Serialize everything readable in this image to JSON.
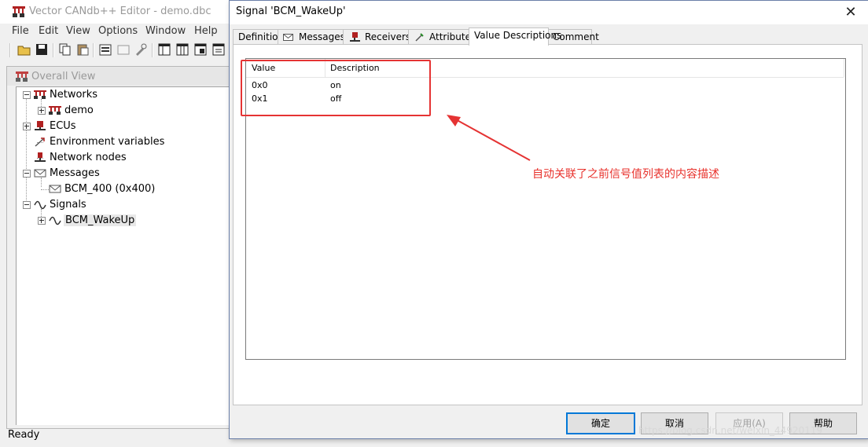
{
  "app": {
    "title": "Vector CANdb++ Editor - demo.dbc",
    "menu": [
      "File",
      "Edit",
      "View",
      "Options",
      "Window",
      "Help"
    ],
    "toolbar_icons": [
      "open-folder-icon",
      "save-icon",
      "copy-icon",
      "paste-icon",
      "properties-icon",
      "view-icon",
      "tool-icon",
      "table-icon-1",
      "table-icon-2",
      "table-icon-3",
      "table-icon-4"
    ],
    "status": "Ready"
  },
  "overall_view": {
    "title": "Overall View",
    "tree": [
      {
        "label": "Networks",
        "icon": "network-icon"
      },
      {
        "label": "demo",
        "icon": "network-icon"
      },
      {
        "label": "ECUs",
        "icon": "ecu-icon"
      },
      {
        "label": "Environment variables",
        "icon": "env-var-icon"
      },
      {
        "label": "Network nodes",
        "icon": "node-icon"
      },
      {
        "label": "Messages",
        "icon": "envelope-icon"
      },
      {
        "label": "BCM_400 (0x400)",
        "icon": "envelope-icon"
      },
      {
        "label": "Signals",
        "icon": "signal-wave-icon"
      },
      {
        "label": "BCM_WakeUp",
        "icon": "signal-wave-icon"
      }
    ]
  },
  "dialog": {
    "title": "Signal 'BCM_WakeUp'",
    "close": "✕",
    "tabs": [
      {
        "label": "Definition"
      },
      {
        "label": "Messages"
      },
      {
        "label": "Receivers"
      },
      {
        "label": "Attributes"
      },
      {
        "label": "Value Descriptions"
      },
      {
        "label": "Comment"
      }
    ],
    "active_tab": "Value Descriptions",
    "table": {
      "columns": [
        "Value",
        "Description"
      ],
      "rows": [
        {
          "value": "0x0",
          "description": "on"
        },
        {
          "value": "0x1",
          "description": "off"
        }
      ]
    },
    "buttons": {
      "ok": "确定",
      "cancel": "取消",
      "apply": "应用(A)",
      "help": "帮助"
    }
  },
  "annotation": {
    "text": "自动关联了之前信号值列表的内容描述",
    "color": "#e8322c"
  },
  "watermark": "https://blog.csdn.net/weixin_44920119"
}
